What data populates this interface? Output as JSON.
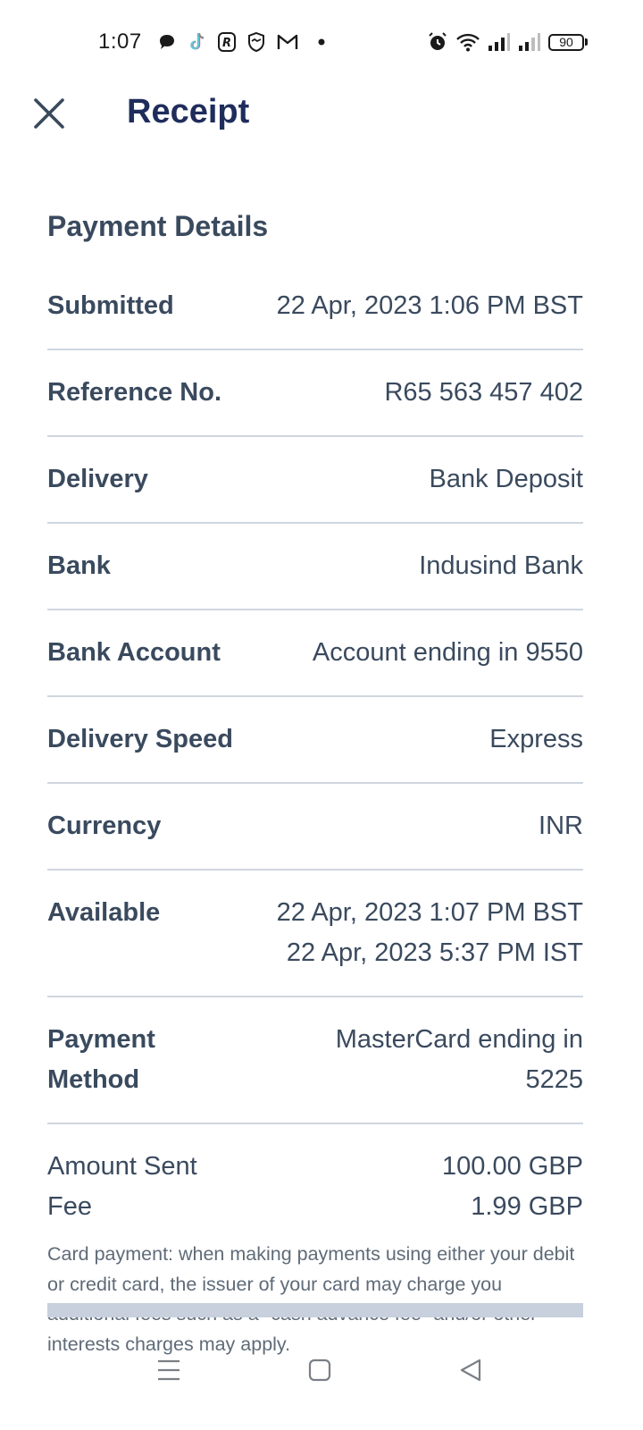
{
  "status_bar": {
    "time": "1:07",
    "battery": "90",
    "left_icons": [
      "chat-bubble-icon",
      "tiktok-icon",
      "r-app-icon",
      "shield-handshake-icon",
      "gmail-icon",
      "dot-icon"
    ],
    "right_icons": [
      "alarm-icon",
      "wifi-icon",
      "signal-icon",
      "signal-icon",
      "battery-icon"
    ]
  },
  "header": {
    "title": "Receipt",
    "close_icon": "close-icon"
  },
  "section": {
    "title": "Payment Details"
  },
  "details": [
    {
      "label": "Submitted",
      "value": "22 Apr, 2023 1:06 PM BST"
    },
    {
      "label": "Reference No.",
      "value": "R65 563 457 402"
    },
    {
      "label": "Delivery",
      "value": "Bank Deposit"
    },
    {
      "label": "Bank",
      "value": "Indusind Bank"
    },
    {
      "label": "Bank Account",
      "value": "Account ending in 9550"
    },
    {
      "label": "Delivery Speed",
      "value": "Express"
    },
    {
      "label": "Currency",
      "value": "INR"
    },
    {
      "label": "Available",
      "value_line1": "22 Apr, 2023 1:07 PM BST",
      "value_line2": "22 Apr, 2023 5:37 PM IST"
    },
    {
      "label": "Payment Method",
      "value": "MasterCard ending in 5225"
    }
  ],
  "amounts": {
    "amount_sent_label": "Amount Sent",
    "amount_sent_value": "100.00 GBP",
    "fee_label": "Fee",
    "fee_value": "1.99 GBP"
  },
  "disclaimer": "Card payment: when making payments using either your debit or credit card, the issuer of your card may charge you additional fees such as a \"cash advance fee\" and/or other interests charges may apply.",
  "nav": {
    "icons": [
      "menu-icon",
      "home-icon",
      "back-icon"
    ]
  },
  "colors": {
    "title": "#1f2d5c",
    "text": "#3a4a5e",
    "divider": "#cfd6de",
    "bottom_bar": "#c7d0dc"
  }
}
